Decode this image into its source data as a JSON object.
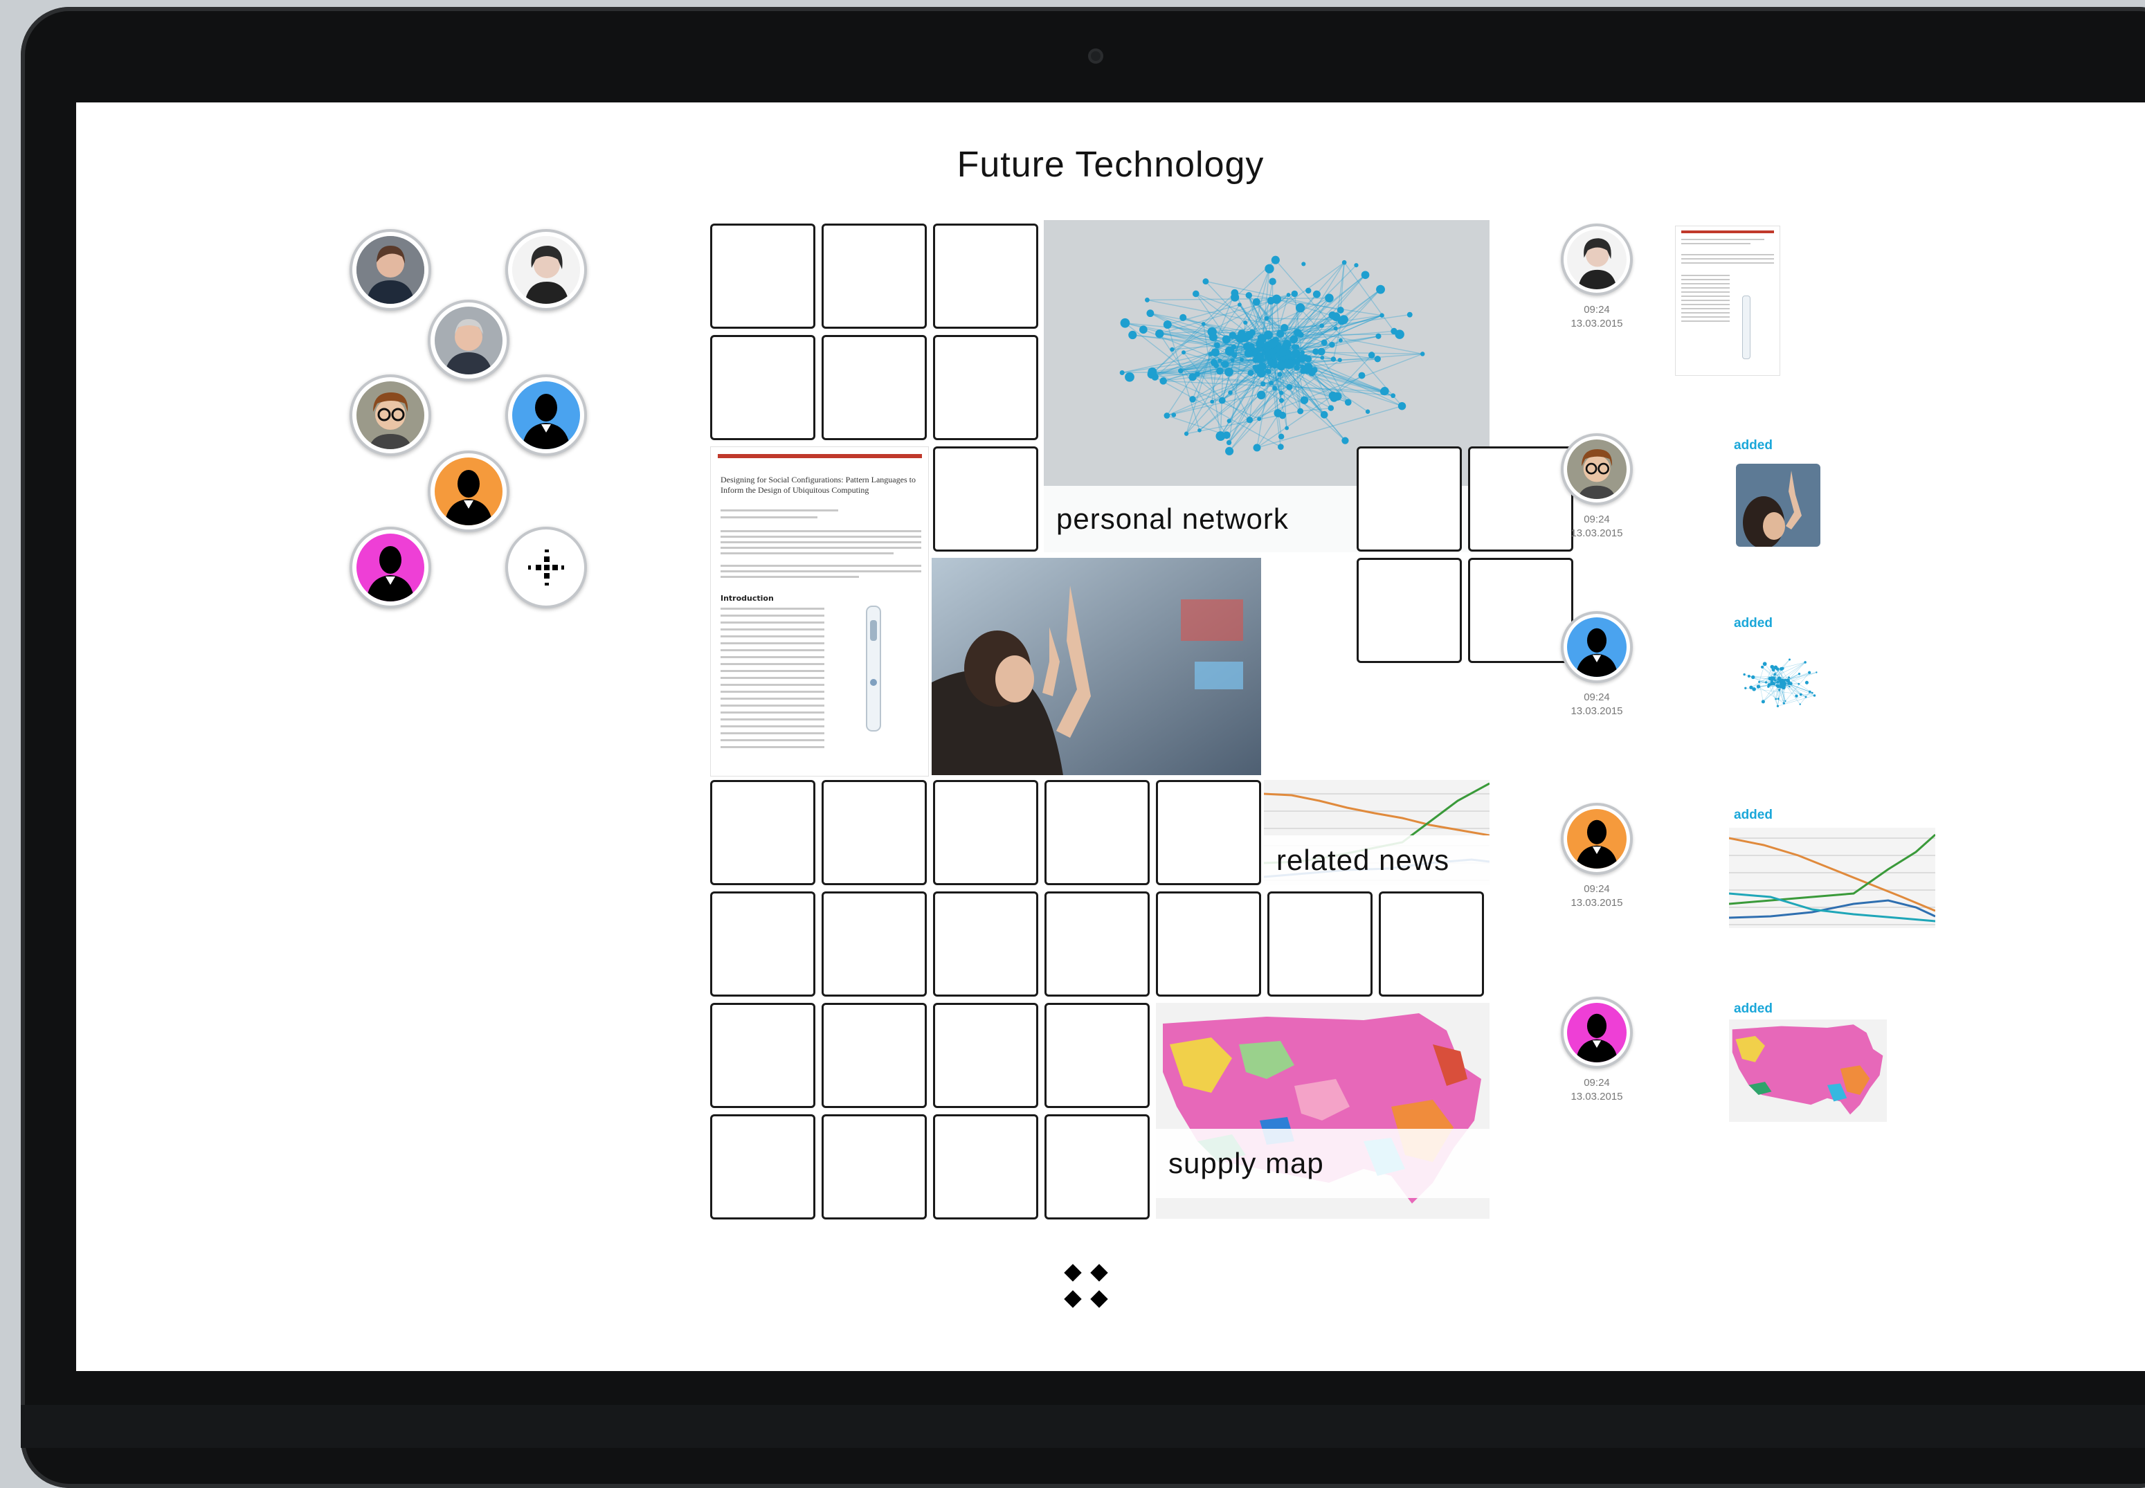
{
  "page": {
    "title": "Future Technology"
  },
  "participants": [
    {
      "name": "avatar-woman-dark-jacket",
      "bg": "#6b7280",
      "kind": "photo"
    },
    {
      "name": "avatar-woman-smiling",
      "bg": "#e5e7eb",
      "kind": "photo"
    },
    {
      "name": "avatar-man-grey-hair",
      "bg": "#9ca3af",
      "kind": "photo"
    },
    {
      "name": "avatar-man-glasses",
      "bg": "#b8a27a",
      "kind": "photo"
    },
    {
      "name": "avatar-silhouette-blue",
      "bg": "#4aa3ef",
      "kind": "silhouette"
    },
    {
      "name": "avatar-silhouette-orange",
      "bg": "#f59a3c",
      "kind": "silhouette"
    },
    {
      "name": "avatar-silhouette-magenta",
      "bg": "#ee3fd6",
      "kind": "silhouette"
    }
  ],
  "add_participant_icon": "move-crosshair-icon",
  "tiles": {
    "personal_network": {
      "label": "personal network"
    },
    "related_news": {
      "label": "related news"
    },
    "supply_map": {
      "label": "supply map"
    },
    "paper": {
      "heading": "Designing for Social Configurations: Pattern Languages to Inform the Design of Ubiquitous Computing",
      "section": "Introduction"
    }
  },
  "feed": [
    {
      "time": "09:24",
      "date": "13.03.2015",
      "action": "",
      "avatar": "avatar-woman-smiling",
      "preview": "paper"
    },
    {
      "time": "09:24",
      "date": "13.03.2015",
      "action": "added",
      "avatar": "avatar-man-glasses",
      "preview": "photo"
    },
    {
      "time": "09:24",
      "date": "13.03.2015",
      "action": "added",
      "avatar": "avatar-silhouette-blue",
      "preview": "network"
    },
    {
      "time": "09:24",
      "date": "13.03.2015",
      "action": "added",
      "avatar": "avatar-silhouette-orange",
      "preview": "chart"
    },
    {
      "time": "09:24",
      "date": "13.03.2015",
      "action": "added",
      "avatar": "avatar-silhouette-magenta",
      "preview": "map"
    }
  ],
  "colors": {
    "accent": "#1ba7d9",
    "network": "#1e9fd0",
    "silhouette_blue": "#4aa3ef",
    "silhouette_orange": "#f59a3c",
    "silhouette_magenta": "#ee3fd6"
  },
  "footer_icon": "grid-diamonds-icon"
}
